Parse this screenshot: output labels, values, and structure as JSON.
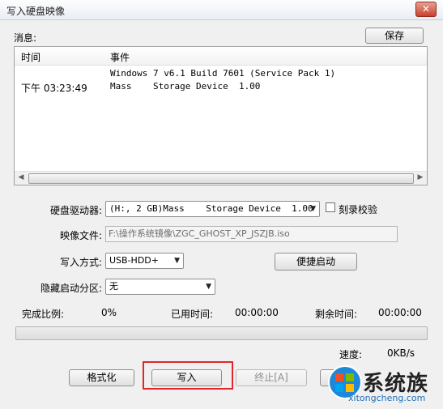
{
  "window": {
    "title": "写入硬盘映像",
    "close_glyph": "✕"
  },
  "messages": {
    "label": "消息:",
    "save_button": "保存",
    "columns": [
      "时间",
      "事件"
    ],
    "rows": [
      {
        "time": "",
        "event": "Windows 7 v6.1 Build 7601 (Service Pack 1)"
      },
      {
        "time": "下午 03:23:49",
        "event": "Mass    Storage Device  1.00"
      }
    ]
  },
  "form": {
    "drive_label": "硬盘驱动器:",
    "drive_value": "(H:, 2 GB)Mass    Storage Device  1.00",
    "verify_label": "刻录校验",
    "image_label": "映像文件:",
    "image_value": "F:\\操作系统镜像\\ZGC_GHOST_XP_JSZJB.iso",
    "write_method_label": "写入方式:",
    "write_method_value": "USB-HDD+",
    "quick_boot_button": "便捷启动",
    "hidden_partition_label": "隐藏启动分区:",
    "hidden_partition_value": "无"
  },
  "status": {
    "complete_label": "完成比例:",
    "complete_value": "0%",
    "elapsed_label": "已用时间:",
    "elapsed_value": "00:00:00",
    "remaining_label": "剩余时间:",
    "remaining_value": "00:00:00",
    "progress_fraction": 0,
    "speed_label": "速度:",
    "speed_value": "0KB/s"
  },
  "buttons": {
    "format": "格式化",
    "write": "写入",
    "abort": "终止[A]",
    "return_partial": "返"
  },
  "watermark": {
    "brand": "系统族",
    "url": "xitongcheng.com"
  },
  "colors": {
    "highlight": "#e3262b",
    "progress_fill": "#37c337"
  }
}
